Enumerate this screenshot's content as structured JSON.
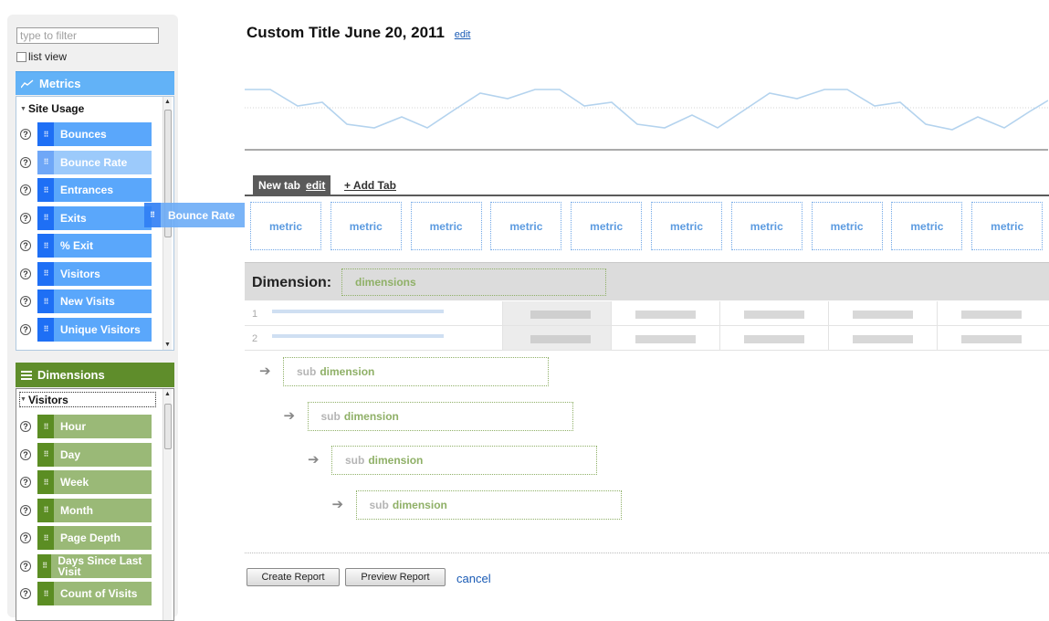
{
  "sidebar": {
    "filter_placeholder": "type to filter",
    "list_view_label": "list view",
    "metrics": {
      "header": "Metrics",
      "group": "Site Usage",
      "items": [
        "Bounces",
        "Bounce Rate",
        "Entrances",
        "Exits",
        "% Exit",
        "Visitors",
        "New Visits",
        "Unique Visitors"
      ]
    },
    "dimensions": {
      "header": "Dimensions",
      "group": "Visitors",
      "items": [
        "Hour",
        "Day",
        "Week",
        "Month",
        "Page Depth",
        "Days Since Last Visit",
        "Count of Visits"
      ]
    },
    "dragging_label": "Bounce Rate",
    "help_glyph": "?"
  },
  "main": {
    "title": "Custom Title June 20, 2011",
    "title_edit": "edit",
    "tab_label": "New tab",
    "tab_edit": "edit",
    "add_tab": "+ Add Tab",
    "metric_slot_label": "metric",
    "metric_slots": [
      "metric",
      "metric",
      "metric",
      "metric",
      "metric",
      "metric",
      "metric",
      "metric",
      "metric",
      "metric"
    ],
    "dimension_label": "Dimension:",
    "dimension_slot": "dimensions",
    "rows": [
      "1",
      "2"
    ],
    "sub_dimensions": [
      {
        "prefix": "sub",
        "word": "dimension"
      },
      {
        "prefix": "sub",
        "word": "dimension"
      },
      {
        "prefix": "sub",
        "word": "dimension"
      },
      {
        "prefix": "sub",
        "word": "dimension"
      }
    ],
    "buttons": {
      "create": "Create Report",
      "preview": "Preview Report",
      "cancel": "cancel"
    }
  },
  "colors": {
    "metric_blue": "#5aa7fb",
    "metric_grip": "#1e6ff5",
    "dimension_green": "#5f8d2b",
    "link_blue": "#1a5bb5"
  }
}
